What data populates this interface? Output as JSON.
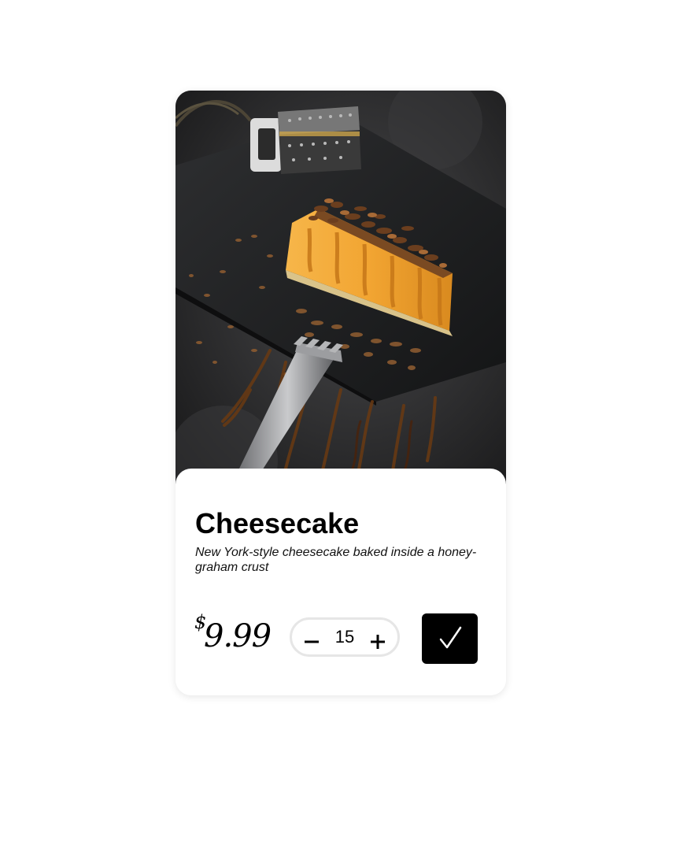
{
  "product": {
    "name": "Cheesecake",
    "description": "New York-style cheesecake baked inside a honey-graham crust",
    "image_alt": "Slice of cheesecake topped with chocolate shavings and caramel drizzle on a dark slate board",
    "price": {
      "currency": "$",
      "amount": "9.99"
    }
  },
  "quantity": {
    "value": "15",
    "decrement_icon": "minus-icon",
    "increment_icon": "plus-icon"
  },
  "confirm": {
    "icon": "checkmark-icon"
  },
  "colors": {
    "card_bg": "#ffffff",
    "button_bg": "#000000",
    "stepper_border": "#e6e6e6",
    "caramel": "#e8a632"
  }
}
